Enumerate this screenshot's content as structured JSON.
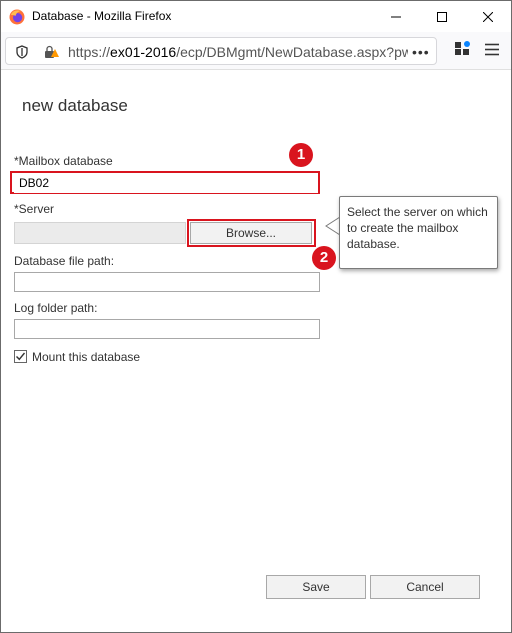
{
  "window": {
    "title": "Database - Mozilla Firefox",
    "minimize_icon": "minimize-icon",
    "maximize_icon": "maximize-icon",
    "close_icon": "close-icon"
  },
  "navbar": {
    "url_prefix": "https://",
    "url_host": "ex01-2016",
    "url_path": "/ecp/DBMgmt/NewDatabase.aspx?pw",
    "more_label": "•••",
    "icons": [
      "shield-icon",
      "lock-icon",
      "extensions-icon",
      "hamburger-menu-icon"
    ]
  },
  "form": {
    "title": "new database",
    "mailbox_label": "*Mailbox database",
    "mailbox_value": "DB02",
    "server_label": "*Server",
    "server_value": "",
    "browse_label": "Browse...",
    "file_path_label": "Database file path:",
    "file_path_value": "",
    "log_path_label": "Log folder path:",
    "log_path_value": "",
    "mount_label": "Mount this database",
    "mount_checked": true,
    "save_label": "Save",
    "cancel_label": "Cancel"
  },
  "annotations": {
    "badge_1": "1",
    "badge_2": "2",
    "highlight_color": "#d9141e"
  },
  "tooltip": {
    "text": "Select the server on which to create the mailbox database."
  }
}
